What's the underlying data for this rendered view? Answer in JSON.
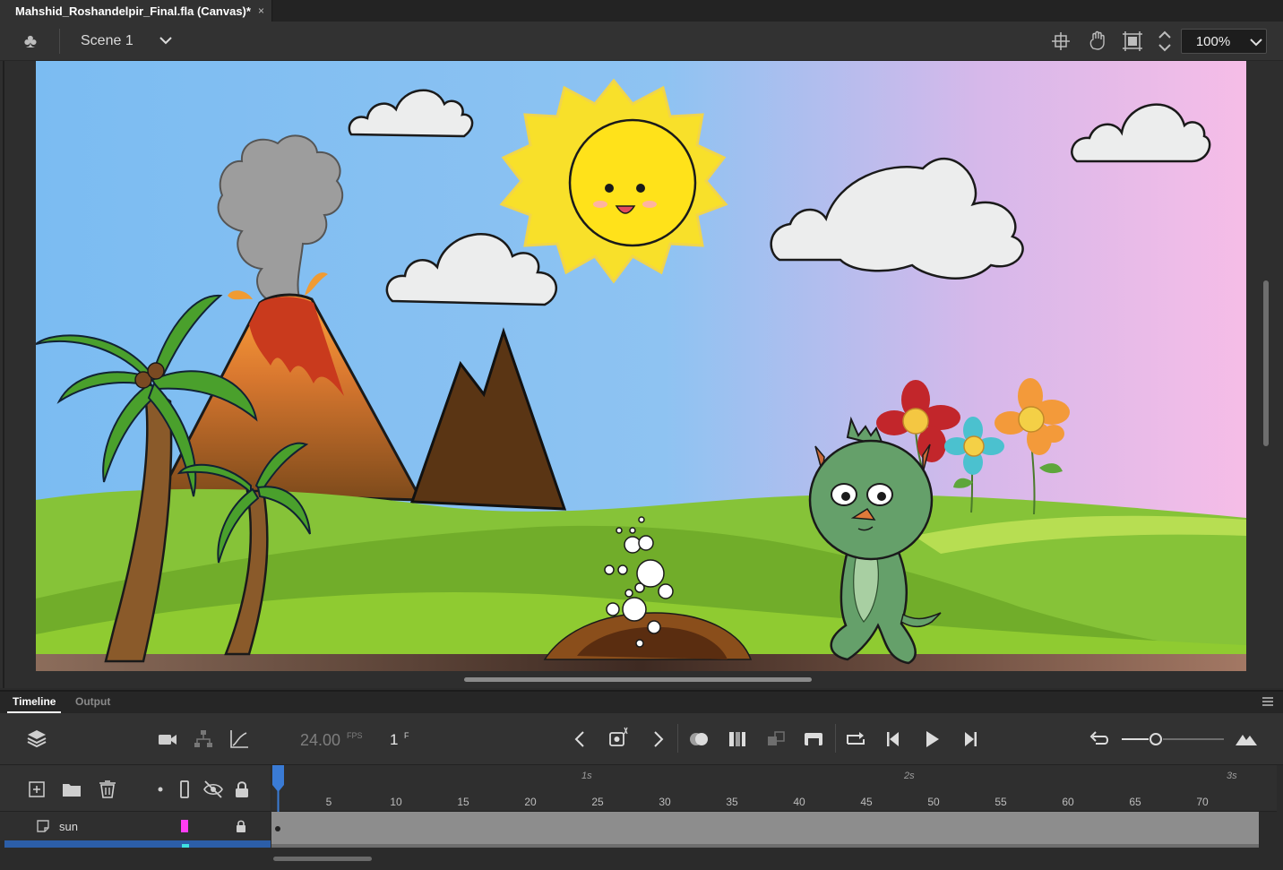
{
  "document_tab": {
    "title": "Mahshid_Roshandelpir_Final.fla (Canvas)*",
    "close_icon": "×"
  },
  "edit_bar": {
    "scene_label": "Scene 1",
    "zoom": "100%",
    "tools": [
      "center-stage-icon",
      "rotate-stage-icon",
      "clip-content-icon",
      "zoom-stepper-icon"
    ]
  },
  "timeline_panel": {
    "tabs": [
      {
        "label": "Timeline",
        "active": true
      },
      {
        "label": "Output",
        "active": false
      }
    ],
    "fps": "24.00",
    "fps_unit": "FPS",
    "current_frame": "1",
    "frame_unit": "F",
    "ruler": {
      "frame_labels": [
        "5",
        "10",
        "15",
        "20",
        "25",
        "30",
        "35",
        "40",
        "45",
        "50",
        "55",
        "60",
        "65",
        "70"
      ],
      "second_labels": [
        "1s",
        "2s",
        "3s"
      ]
    },
    "layers": [
      {
        "name": "sun",
        "color": "#ff3df2",
        "locked": true
      },
      {
        "name": "",
        "color": "#3fe0e0",
        "selected": true
      }
    ]
  },
  "colors": {
    "accent_blue": "#2c5ea8",
    "sky_left": "#7cbcf0",
    "sky_right": "#f4bde8",
    "grass": "#8ac52b"
  }
}
